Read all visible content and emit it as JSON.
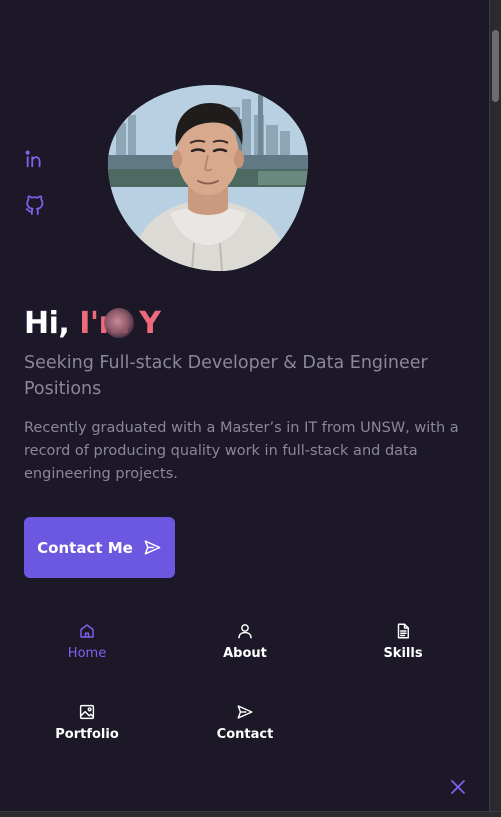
{
  "social": {
    "linkedin_icon": "linkedin-icon",
    "github_icon": "github-icon"
  },
  "hero": {
    "greeting_prefix": "Hi,",
    "greeting_name": "I'm Y",
    "subtitle": "Seeking Full-stack Developer & Data Engineer Positions",
    "description": "Recently graduated with a Master’s in IT from UNSW, with a record of producing quality work in full-stack and data engineering projects.",
    "cta_label": "Contact Me",
    "cta_icon": "send-icon"
  },
  "nav": {
    "items": [
      {
        "label": "Home",
        "icon": "home-icon",
        "active": true
      },
      {
        "label": "About",
        "icon": "user-icon",
        "active": false
      },
      {
        "label": "Skills",
        "icon": "document-icon",
        "active": false
      },
      {
        "label": "Portfolio",
        "icon": "image-icon",
        "active": false
      },
      {
        "label": "Contact",
        "icon": "send-icon",
        "active": false
      }
    ],
    "close_icon": "close-icon"
  },
  "colors": {
    "background": "#1c1828",
    "accent": "#6c57e0",
    "accent_text": "#7b63ec",
    "name_highlight": "#ec6a7c",
    "muted_text": "#8b8796"
  }
}
